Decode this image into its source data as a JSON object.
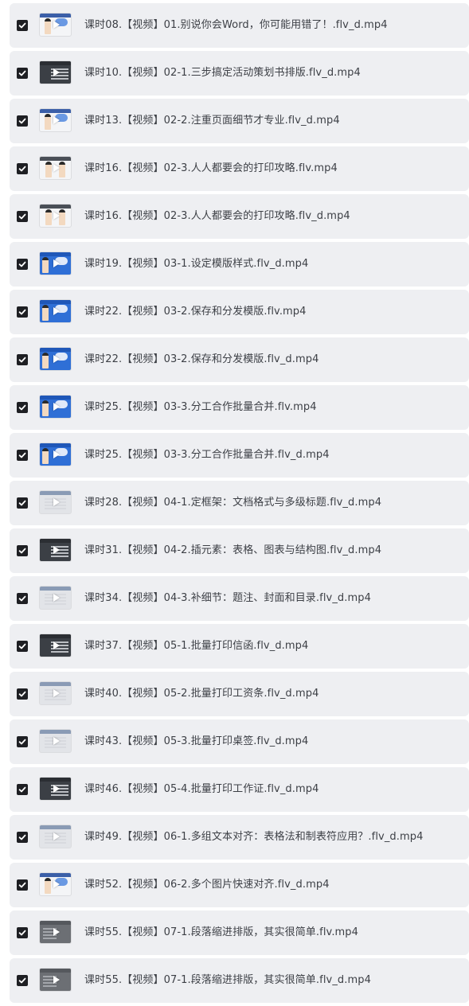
{
  "colors": {
    "row_bg": "#eeeff2",
    "text": "#3c3f45",
    "checkbox": "#1e1f23",
    "page_bg": "#ffffff"
  },
  "files": [
    {
      "label": "课时08.【视频】01.别说你会Word，你可能用错了！.flv_d.mp4",
      "checked": true,
      "thumb": "thumb-presenter-white"
    },
    {
      "label": "课时10.【视频】02-1.三步搞定活动策划书排版.flv_d.mp4",
      "checked": true,
      "thumb": "thumb-document-dark"
    },
    {
      "label": "课时13.【视频】02-2.注重页面细节才专业.flv_d.mp4",
      "checked": true,
      "thumb": "thumb-presenter-white"
    },
    {
      "label": "课时16.【视频】02-3.人人都要会的打印攻略.flv.mp4",
      "checked": true,
      "thumb": "thumb-two-presenters"
    },
    {
      "label": "课时16.【视频】02-3.人人都要会的打印攻略.flv_d.mp4",
      "checked": true,
      "thumb": "thumb-two-presenters"
    },
    {
      "label": "课时19.【视频】03-1.设定模版样式.flv_d.mp4",
      "checked": true,
      "thumb": "thumb-presenter-blue"
    },
    {
      "label": "课时22.【视频】03-2.保存和分发模版.flv.mp4",
      "checked": true,
      "thumb": "thumb-presenter-blue"
    },
    {
      "label": "课时22.【视频】03-2.保存和分发模版.flv_d.mp4",
      "checked": true,
      "thumb": "thumb-presenter-blue"
    },
    {
      "label": "课时25.【视频】03-3.分工合作批量合并.flv.mp4",
      "checked": true,
      "thumb": "thumb-presenter-blue"
    },
    {
      "label": "课时25.【视频】03-3.分工合作批量合并.flv_d.mp4",
      "checked": true,
      "thumb": "thumb-presenter-blue"
    },
    {
      "label": "课时28.【视频】04-1.定框架：文档格式与多级标题.flv_d.mp4",
      "checked": true,
      "thumb": "thumb-document-light"
    },
    {
      "label": "课时31.【视频】04-2.插元素：表格、图表与结构图.flv_d.mp4",
      "checked": true,
      "thumb": "thumb-document-dark"
    },
    {
      "label": "课时34.【视频】04-3.补细节：题注、封面和目录.flv_d.mp4",
      "checked": true,
      "thumb": "thumb-document-light"
    },
    {
      "label": "课时37.【视频】05-1.批量打印信函.flv_d.mp4",
      "checked": true,
      "thumb": "thumb-document-dark"
    },
    {
      "label": "课时40.【视频】05-2.批量打印工资条.flv_d.mp4",
      "checked": true,
      "thumb": "thumb-document-light"
    },
    {
      "label": "课时43.【视频】05-3.批量打印桌签.flv_d.mp4",
      "checked": true,
      "thumb": "thumb-document-light"
    },
    {
      "label": "课时46.【视频】05-4.批量打印工作证.flv_d.mp4",
      "checked": true,
      "thumb": "thumb-document-dark"
    },
    {
      "label": "课时49.【视频】06-1.多组文本对齐：表格法和制表符应用？.flv_d.mp4",
      "checked": true,
      "thumb": "thumb-document-light"
    },
    {
      "label": "课时52.【视频】06-2.多个图片快速对齐.flv_d.mp4",
      "checked": true,
      "thumb": "thumb-presenter-white"
    },
    {
      "label": "课时55.【视频】07-1.段落缩进排版，其实很简单.flv.mp4",
      "checked": true,
      "thumb": "thumb-document-mid"
    },
    {
      "label": "课时55.【视频】07-1.段落缩进排版，其实很简单.flv_d.mp4",
      "checked": true,
      "thumb": "thumb-document-mid"
    }
  ]
}
